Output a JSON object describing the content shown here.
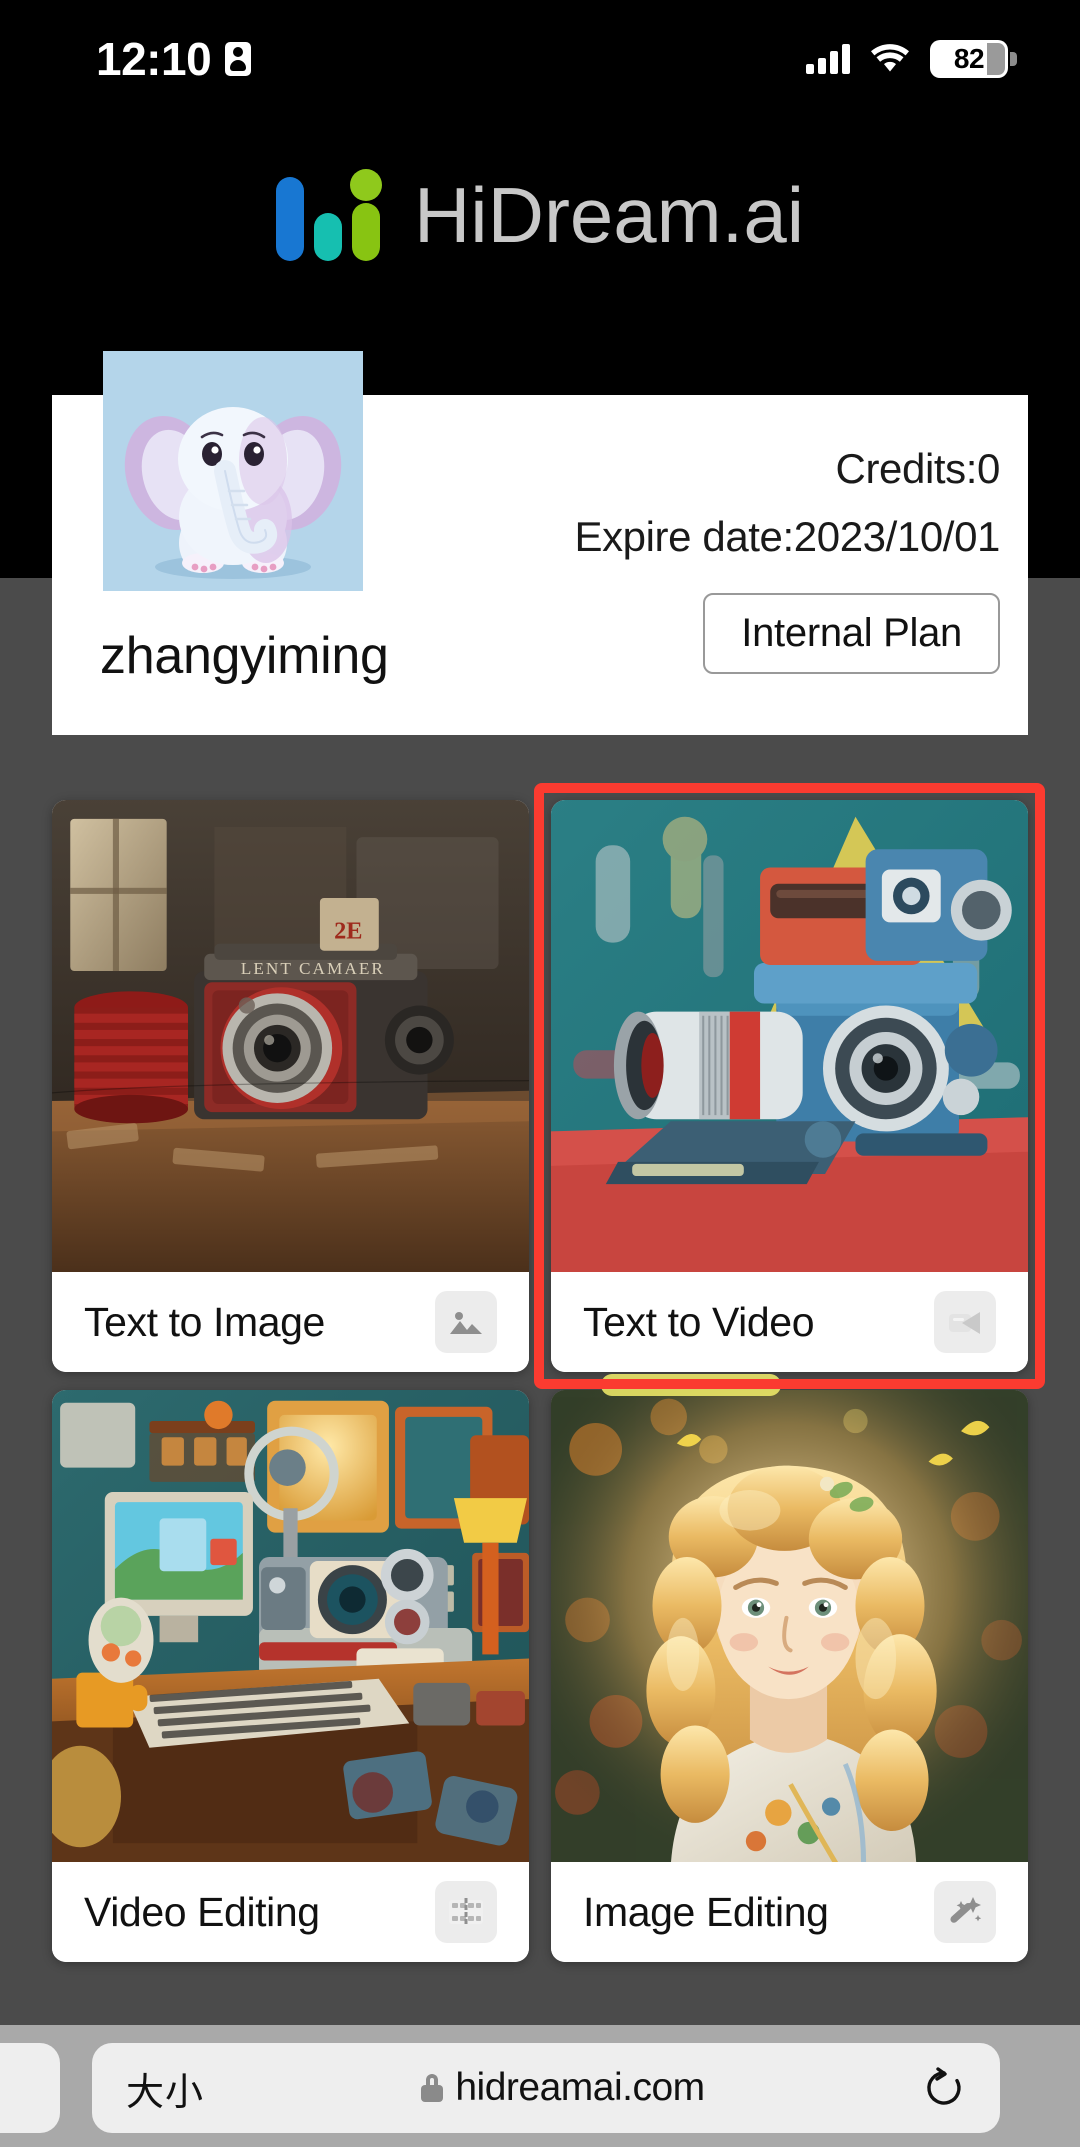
{
  "status_bar": {
    "time": "12:10",
    "recording_icon": "screen-record-icon",
    "signal_icon": "cellular-signal-icon",
    "wifi_icon": "wifi-icon",
    "battery_level": "82"
  },
  "brand": {
    "logo_icon": "hidream-bars-logo-icon",
    "name": "HiDream.ai",
    "logo_colors": {
      "blue": "#1877d2",
      "teal": "#16bfb0",
      "green": "#88c412"
    }
  },
  "profile": {
    "avatar_icon": "elephant-avatar",
    "username": "zhangyiming",
    "credits": "Credits:0",
    "expire": "Expire date:2023/10/01",
    "plan_button": "Internal Plan"
  },
  "features": [
    {
      "label": "Text to Image",
      "icon": "photo-icon",
      "selected": false
    },
    {
      "label": "Text to Video",
      "icon": "video-camera-icon",
      "selected": true
    },
    {
      "label": "Video Editing",
      "icon": "film-strip-icon",
      "selected": false
    },
    {
      "label": "Image Editing",
      "icon": "magic-wand-icon",
      "selected": false
    }
  ],
  "selection": {
    "highlight_color": "#fb3b30"
  },
  "browser": {
    "text_size_label": "大小",
    "lock_icon": "lock-icon",
    "url": "hidreamai.com",
    "reload_icon": "reload-icon"
  }
}
